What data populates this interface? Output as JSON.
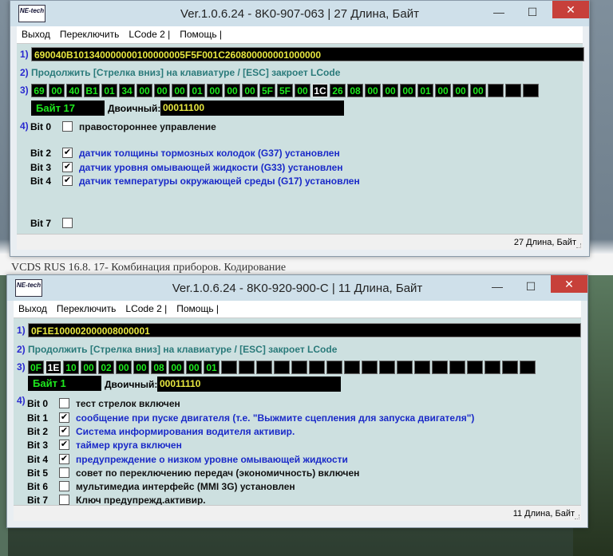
{
  "background": {
    "strip_text": "VCDS RUS 16.8. 17- Комбинация приборов. Кодирование"
  },
  "windows": [
    {
      "logo": "NE-tech",
      "title": "Ver.1.0.6.24 -   8K0-907-063 | 27 Длина, Байт",
      "menu": [
        "Выход",
        "Переключить",
        "LCode 2 |",
        "Помощь |"
      ],
      "row1_num": "1)",
      "lcode": "690040B101340000000100000005F5F001C260800000001000000",
      "row2_num": "2)",
      "continue_text": "Продолжить [Стрелка вниз] на клавиатуре / [ESC] закроет LCode",
      "row3_num": "3)",
      "bytes": [
        "69",
        "00",
        "40",
        "B1",
        "01",
        "34",
        "00",
        "00",
        "00",
        "01",
        "00",
        "00",
        "00",
        "5F",
        "5F",
        "00",
        "1C",
        "26",
        "08",
        "00",
        "00",
        "00",
        "01",
        "00",
        "00",
        "00",
        "",
        "",
        ""
      ],
      "selected_byte": 16,
      "byte_label": "Байт 17",
      "binary_label": "Двоичный:",
      "binary_value": "00011100",
      "row4_num": "4)",
      "bits": [
        {
          "label": "Bit 0",
          "checked": false,
          "check_mark": "",
          "desc": "правостороннее управление"
        },
        {
          "label": "Bit 2",
          "checked": true,
          "check_mark": "✔",
          "desc": "датчик толщины тормозных колодок (G37) установлен"
        },
        {
          "label": "Bit 3",
          "checked": true,
          "check_mark": "✔",
          "desc": "датчик уровня омывающей жидкости (G33) установлен"
        },
        {
          "label": "Bit 4",
          "checked": true,
          "check_mark": "✔",
          "desc": "датчик температуры окружающей среды (G17) установлен"
        },
        {
          "label": "Bit 7",
          "checked": false,
          "check_mark": "",
          "desc": ""
        }
      ],
      "status": "27 Длина, Байт"
    },
    {
      "logo": "NE-tech",
      "title": "Ver.1.0.6.24 -   8K0-920-900-C | 11 Длина, Байт",
      "menu": [
        "Выход",
        "Переключить",
        "LCode 2 |",
        "Помощь |"
      ],
      "row1_num": "1)",
      "lcode": "0F1E100002000008000001",
      "row2_num": "2)",
      "continue_text": "Продолжить [Стрелка вниз] на клавиатуре / [ESC] закроет LCode",
      "row3_num": "3)",
      "bytes": [
        "0F",
        "1E",
        "10",
        "00",
        "02",
        "00",
        "00",
        "08",
        "00",
        "00",
        "01",
        "",
        "",
        "",
        "",
        "",
        "",
        "",
        "",
        "",
        "",
        "",
        "",
        "",
        "",
        "",
        "",
        "",
        ""
      ],
      "selected_byte": 1,
      "byte_label": "Байт 1",
      "binary_label": "Двоичный:",
      "binary_value": "00011110",
      "row4_num": "4)",
      "bits": [
        {
          "label": "Bit 0",
          "checked": false,
          "check_mark": "",
          "desc": "тест стрелок включен"
        },
        {
          "label": "Bit 1",
          "checked": true,
          "check_mark": "✔",
          "desc": "сообщение при пуске двигателя (т.е. \"Выжмите сцепления для запуска двигателя\")"
        },
        {
          "label": "Bit 2",
          "checked": true,
          "check_mark": "✔",
          "desc": "Система информирования водителя активир."
        },
        {
          "label": "Bit 3",
          "checked": true,
          "check_mark": "✔",
          "desc": "таймер круга включен"
        },
        {
          "label": "Bit 4",
          "checked": true,
          "check_mark": "✔",
          "desc": "предупреждение о низком уровне омывающей жидкости"
        },
        {
          "label": "Bit 5",
          "checked": false,
          "check_mark": "",
          "desc": "совет по переключению передач (экономичность) включен"
        },
        {
          "label": "Bit 6",
          "checked": false,
          "check_mark": "",
          "desc": "мультимедиа интерфейс (MMI 3G) установлен"
        },
        {
          "label": "Bit 7",
          "checked": false,
          "check_mark": "",
          "desc": "Ключ предупрежд.активир."
        }
      ],
      "status": "11 Длина, Байт"
    }
  ]
}
